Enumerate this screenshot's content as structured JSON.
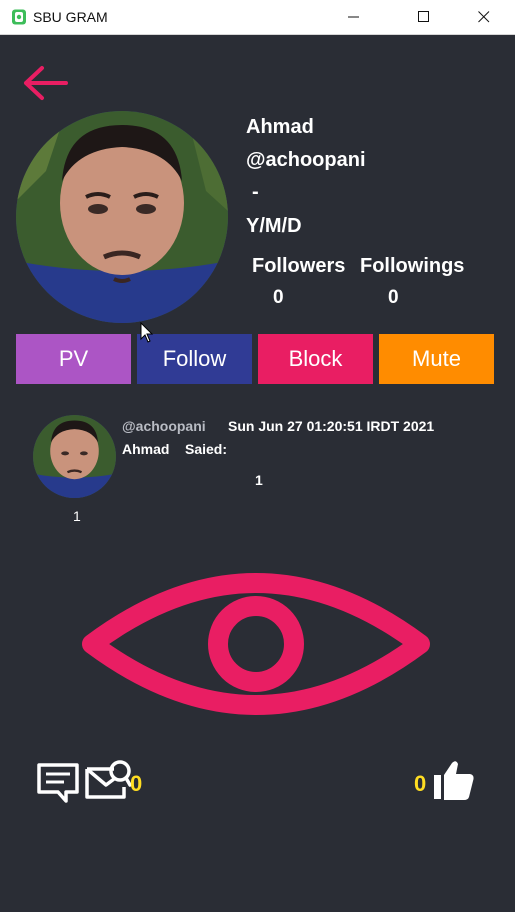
{
  "window": {
    "title": "SBU GRAM"
  },
  "profile": {
    "name": "Ahmad",
    "username": "@achoopani",
    "bio": "-",
    "birthdate": "Y/M/D",
    "followers_label": "Followers",
    "followings_label": "Followings",
    "followers_count": "0",
    "followings_count": "0"
  },
  "actions": {
    "pv": "PV",
    "follow": "Follow",
    "block": "Block",
    "mute": "Mute"
  },
  "post": {
    "username": "@achoopani",
    "date": "Sun Jun 27 01:20:51 IRDT 2021",
    "author": "Ahmad",
    "said_label": "Saied:",
    "content": "1",
    "count": "1",
    "share_count": "0",
    "like_count": "0"
  },
  "colors": {
    "background": "#2a2d35",
    "accent": "#e91e63",
    "pv": "#ac55c5",
    "follow": "#303b95",
    "block": "#e91e63",
    "mute": "#ff8c00",
    "counts": "#ffdd22"
  },
  "icons": {
    "back": "arrow-left-icon",
    "eye": "eye-icon",
    "comment": "comment-icon",
    "share": "mail-share-icon",
    "like": "thumbs-up-icon"
  }
}
